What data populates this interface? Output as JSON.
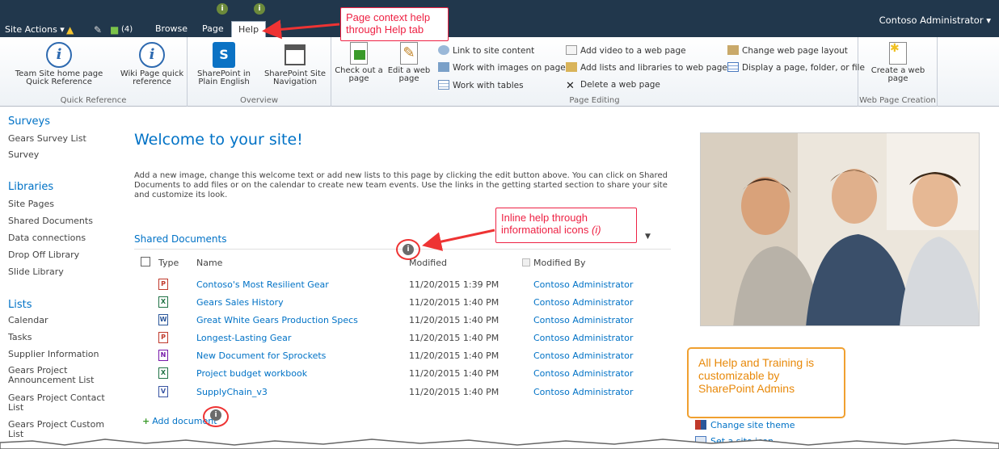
{
  "topbar": {
    "site_actions": "Site Actions ▾",
    "badge_count": "(4)",
    "tabs": [
      {
        "label": "Browse"
      },
      {
        "label": "Page"
      },
      {
        "label": "Help"
      }
    ],
    "user": "Contoso Administrator ▾"
  },
  "ribbon": {
    "groups": {
      "quick_reference": "Quick Reference",
      "overview": "Overview",
      "page_editing": "Page Editing",
      "web_page_creation": "Web Page Creation"
    },
    "buttons": {
      "team_site": "Team Site home page Quick Reference",
      "wiki_page": "Wiki Page quick reference",
      "sp_plain_english": "SharePoint in Plain English",
      "sp_site_nav": "SharePoint Site Navigation",
      "check_out": "Check out a page",
      "edit_web_page": "Edit a web page",
      "link_site_content": "Link to site content",
      "work_images": "Work with images on pages",
      "work_tables": "Work with tables",
      "add_video": "Add video to a web page",
      "add_lists": "Add lists and libraries to web pages",
      "delete_web_page": "Delete a web page",
      "change_layout": "Change web page layout",
      "display_page": "Display a page, folder, or file",
      "create_web_page": "Create a web page"
    }
  },
  "leftnav": {
    "surveys_head": "Surveys",
    "surveys": [
      "Gears Survey List",
      "Survey"
    ],
    "libraries_head": "Libraries",
    "libraries": [
      "Site Pages",
      "Shared Documents",
      "Data connections",
      "Drop Off Library",
      "Slide Library"
    ],
    "lists_head": "Lists",
    "lists": [
      "Calendar",
      "Tasks",
      "Supplier Information",
      "Gears Project Announcement List",
      "Gears Project Contact List",
      "Gears Project Custom List"
    ]
  },
  "main": {
    "welcome": "Welcome to your site!",
    "intro": "Add a new image, change this welcome text or add new lists to this page by clicking the edit button above. You can click on Shared Documents to add files or on the calendar to create new team events. Use the links in the getting started section to share your site and customize its look.",
    "shared_docs_title": "Shared Documents",
    "columns": {
      "type": "Type",
      "name": "Name",
      "modified": "Modified",
      "modified_by": "Modified By"
    },
    "docs": [
      {
        "type": "ppt",
        "name": "Contoso's Most Resilient Gear",
        "modified": "11/20/2015 1:39 PM",
        "by": "Contoso Administrator"
      },
      {
        "type": "xls",
        "name": "Gears Sales History",
        "modified": "11/20/2015 1:40 PM",
        "by": "Contoso Administrator"
      },
      {
        "type": "doc",
        "name": "Great White Gears Production Specs",
        "modified": "11/20/2015 1:40 PM",
        "by": "Contoso Administrator"
      },
      {
        "type": "ppt",
        "name": "Longest-Lasting Gear",
        "modified": "11/20/2015 1:40 PM",
        "by": "Contoso Administrator"
      },
      {
        "type": "one",
        "name": "New Document for Sprockets",
        "modified": "11/20/2015 1:40 PM",
        "by": "Contoso Administrator"
      },
      {
        "type": "xls",
        "name": "Project budget workbook",
        "modified": "11/20/2015 1:40 PM",
        "by": "Contoso Administrator"
      },
      {
        "type": "vsd",
        "name": "SupplyChain_v3",
        "modified": "11/20/2015 1:40 PM",
        "by": "Contoso Administrator"
      }
    ],
    "add_document": "Add document"
  },
  "right_links": {
    "change_theme": "Change site theme",
    "set_icon": "Set a site icon"
  },
  "callouts": {
    "help_tab": "Page context help through Help tab",
    "inline_help_1": "Inline help through",
    "inline_help_2": "informational icons",
    "inline_help_3": "(i)",
    "customizable": "All Help and Training is customizable by SharePoint Admins"
  },
  "colors": {
    "topbar": "#21374c",
    "link": "#0072c6",
    "callout_red": "#e22244",
    "callout_orange": "#f0a030"
  }
}
